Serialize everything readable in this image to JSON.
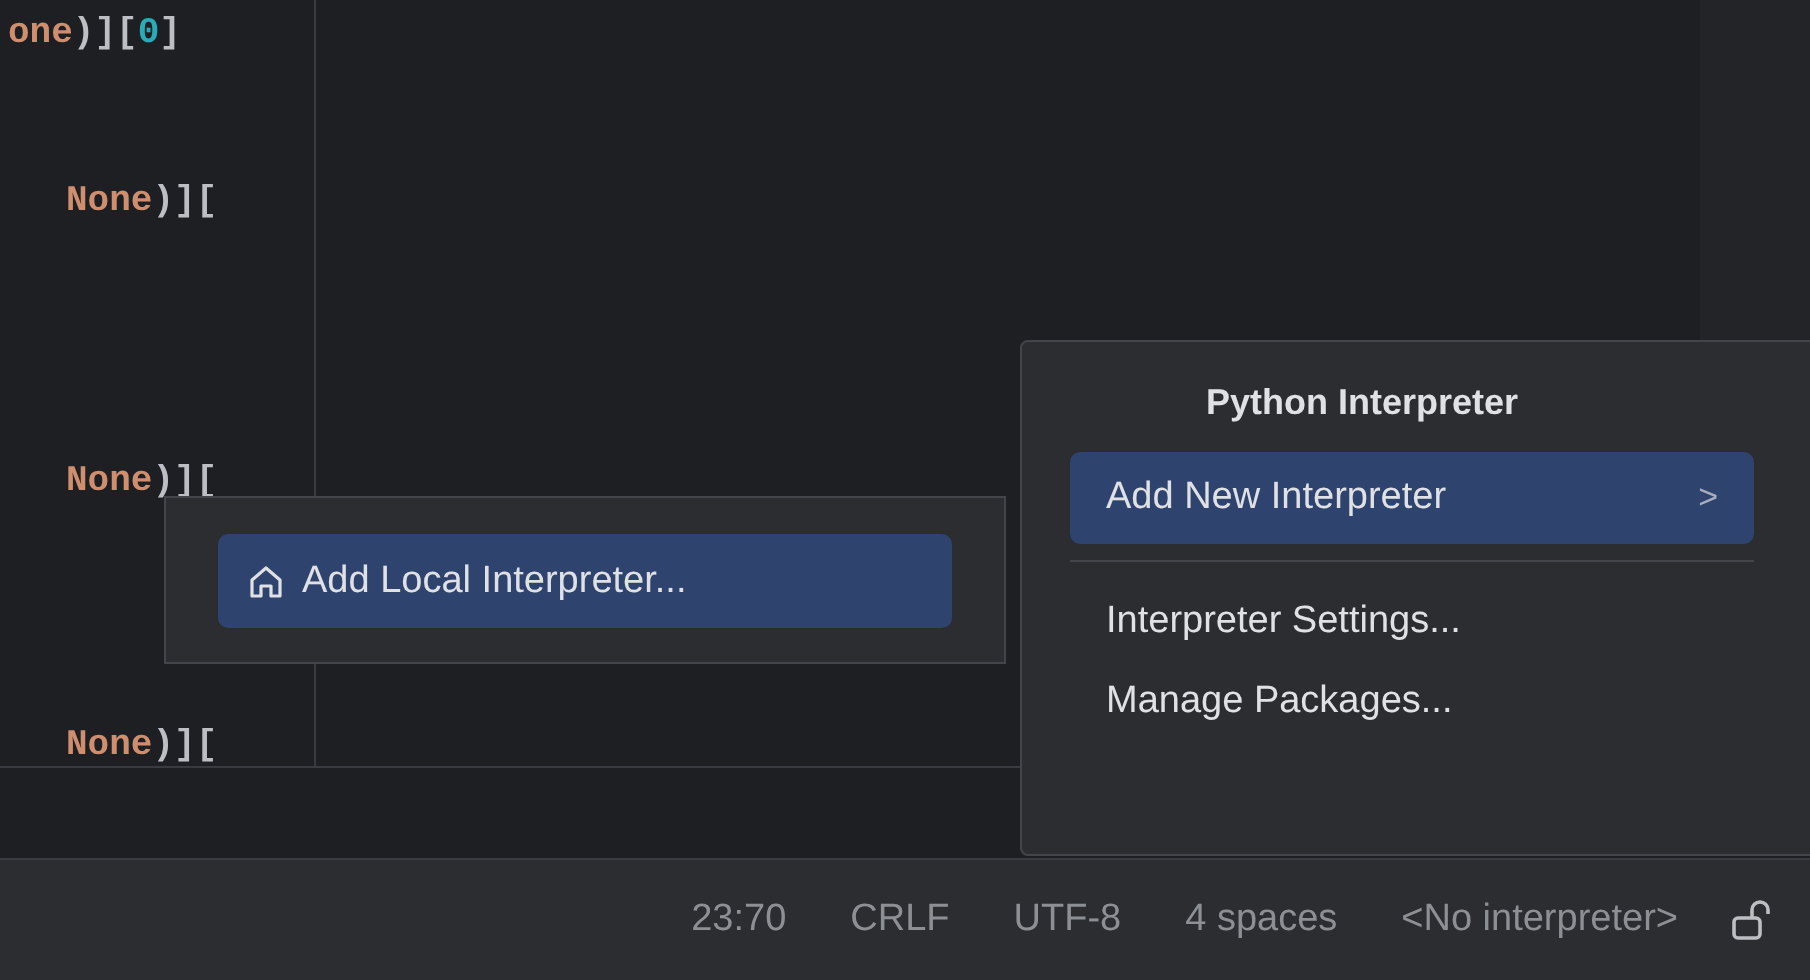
{
  "code_lines": [
    {
      "tokens": [
        {
          "kind": "name",
          "text": "one"
        },
        {
          "kind": "punct",
          "text": ")]["
        },
        {
          "kind": "number",
          "text": "0"
        },
        {
          "kind": "punct",
          "text": "]"
        }
      ]
    },
    {
      "tokens": [
        {
          "kind": "name",
          "text": "None"
        },
        {
          "kind": "punct",
          "text": ")]["
        }
      ]
    },
    {
      "tokens": [
        {
          "kind": "name",
          "text": "None"
        },
        {
          "kind": "punct",
          "text": ")]["
        }
      ]
    },
    {
      "tokens": [
        {
          "kind": "name",
          "text": "None"
        },
        {
          "kind": "punct",
          "text": ")]["
        }
      ]
    }
  ],
  "interpreter_popup": {
    "title": "Python Interpreter",
    "items": [
      {
        "kind": "submenu",
        "label": "Add New Interpreter",
        "arrow": ">",
        "selected": true
      },
      {
        "kind": "separator"
      },
      {
        "kind": "action",
        "label": "Interpreter Settings...",
        "selected": false
      },
      {
        "kind": "action",
        "label": "Manage Packages...",
        "selected": false
      }
    ]
  },
  "submenu": {
    "items": [
      {
        "label": "Add Local Interpreter...",
        "selected": true
      }
    ]
  },
  "status_bar": {
    "items": [
      "23:70",
      "CRLF",
      "UTF-8",
      "4 spaces",
      "<No interpreter>"
    ],
    "locked": false
  }
}
